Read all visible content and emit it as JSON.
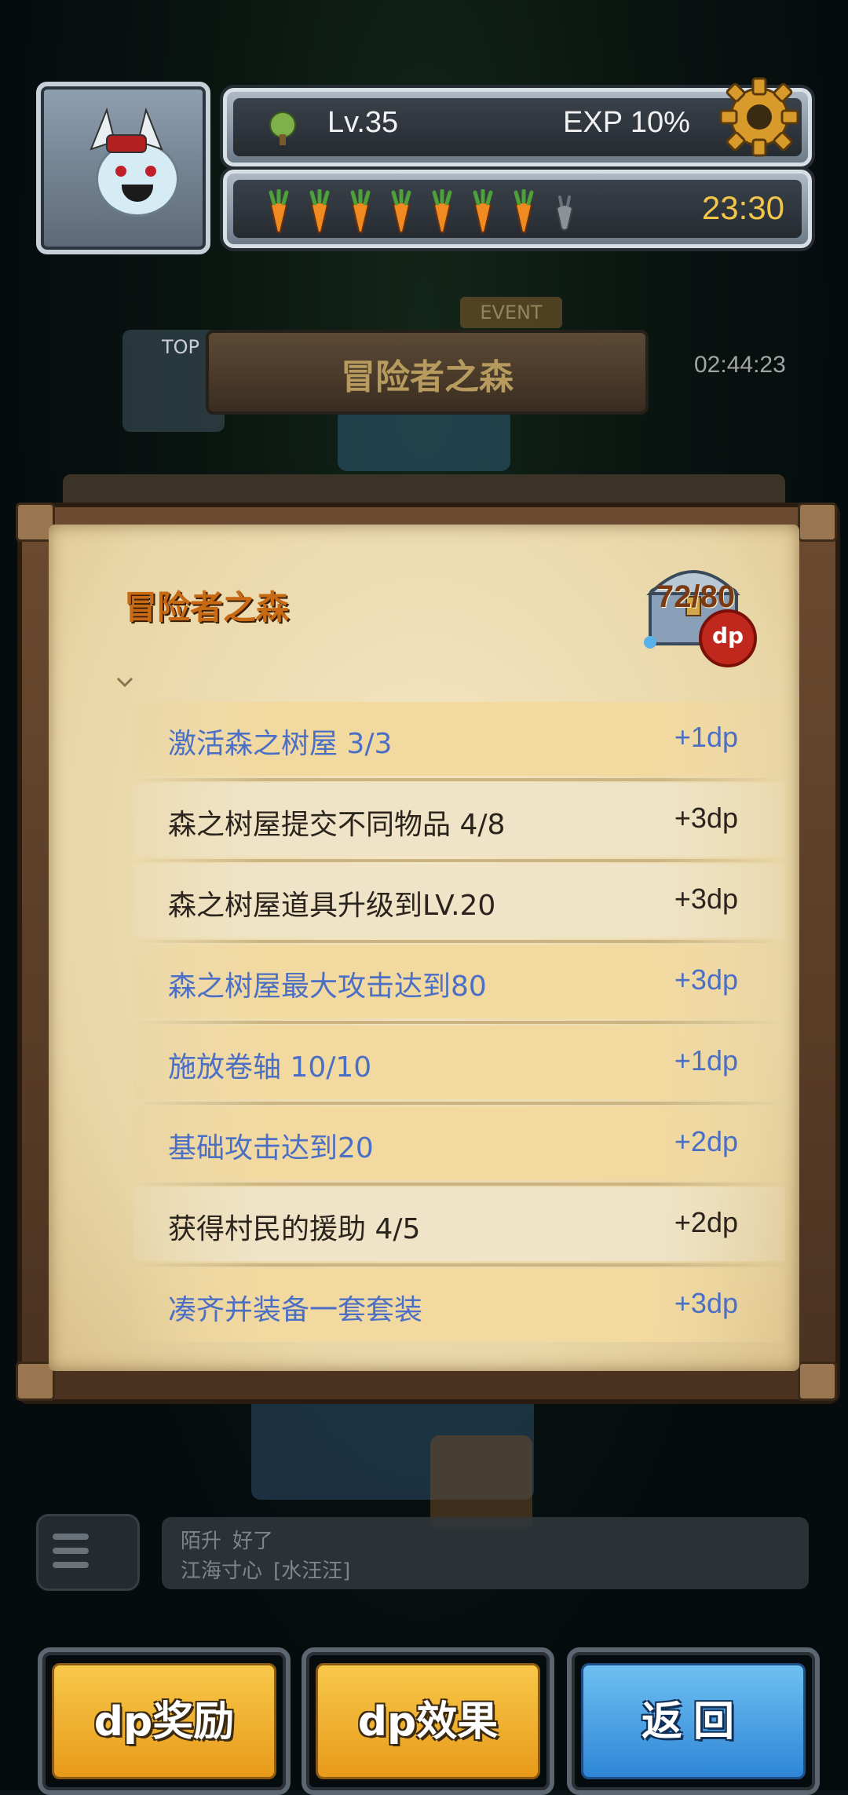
{
  "hud": {
    "level": "Lv.35",
    "exp": "EXP 10%",
    "stamina_full": 7,
    "stamina_total": 8,
    "timer": "23:30"
  },
  "map": {
    "region_title": "冒险者之森",
    "event_tag": "EVENT",
    "top_tag": "TOP",
    "side_timer": "02:44:23"
  },
  "panel": {
    "title": "冒险者之森",
    "dp_progress": "72/80",
    "dp_badge": "dp",
    "tasks": [
      {
        "label": "激活森之树屋 3/3",
        "reward": "+1dp",
        "done": true
      },
      {
        "label": "森之树屋提交不同物品 4/8",
        "reward": "+3dp",
        "done": false
      },
      {
        "label": "森之树屋道具升级到LV.20",
        "reward": "+3dp",
        "done": false
      },
      {
        "label": "森之树屋最大攻击达到80",
        "reward": "+3dp",
        "done": true
      },
      {
        "label": "施放卷轴 10/10",
        "reward": "+1dp",
        "done": true
      },
      {
        "label": "基础攻击达到20",
        "reward": "+2dp",
        "done": true
      },
      {
        "label": "获得村民的援助 4/5",
        "reward": "+2dp",
        "done": false
      },
      {
        "label": "凑齐并装备一套套装",
        "reward": "+3dp",
        "done": true
      }
    ]
  },
  "chat": {
    "lines": [
      {
        "user": "陌升",
        "message": "好了"
      },
      {
        "user": "江海寸心",
        "message": "[水汪汪]"
      }
    ]
  },
  "buttons": {
    "dp_reward": "dp奖励",
    "dp_effect": "dp效果",
    "back": "返回"
  },
  "colors": {
    "done_text": "#4b6fc4",
    "todo_text": "#2b241c",
    "title_orange": "#c86a14",
    "timer_gold": "#f1c64a"
  }
}
